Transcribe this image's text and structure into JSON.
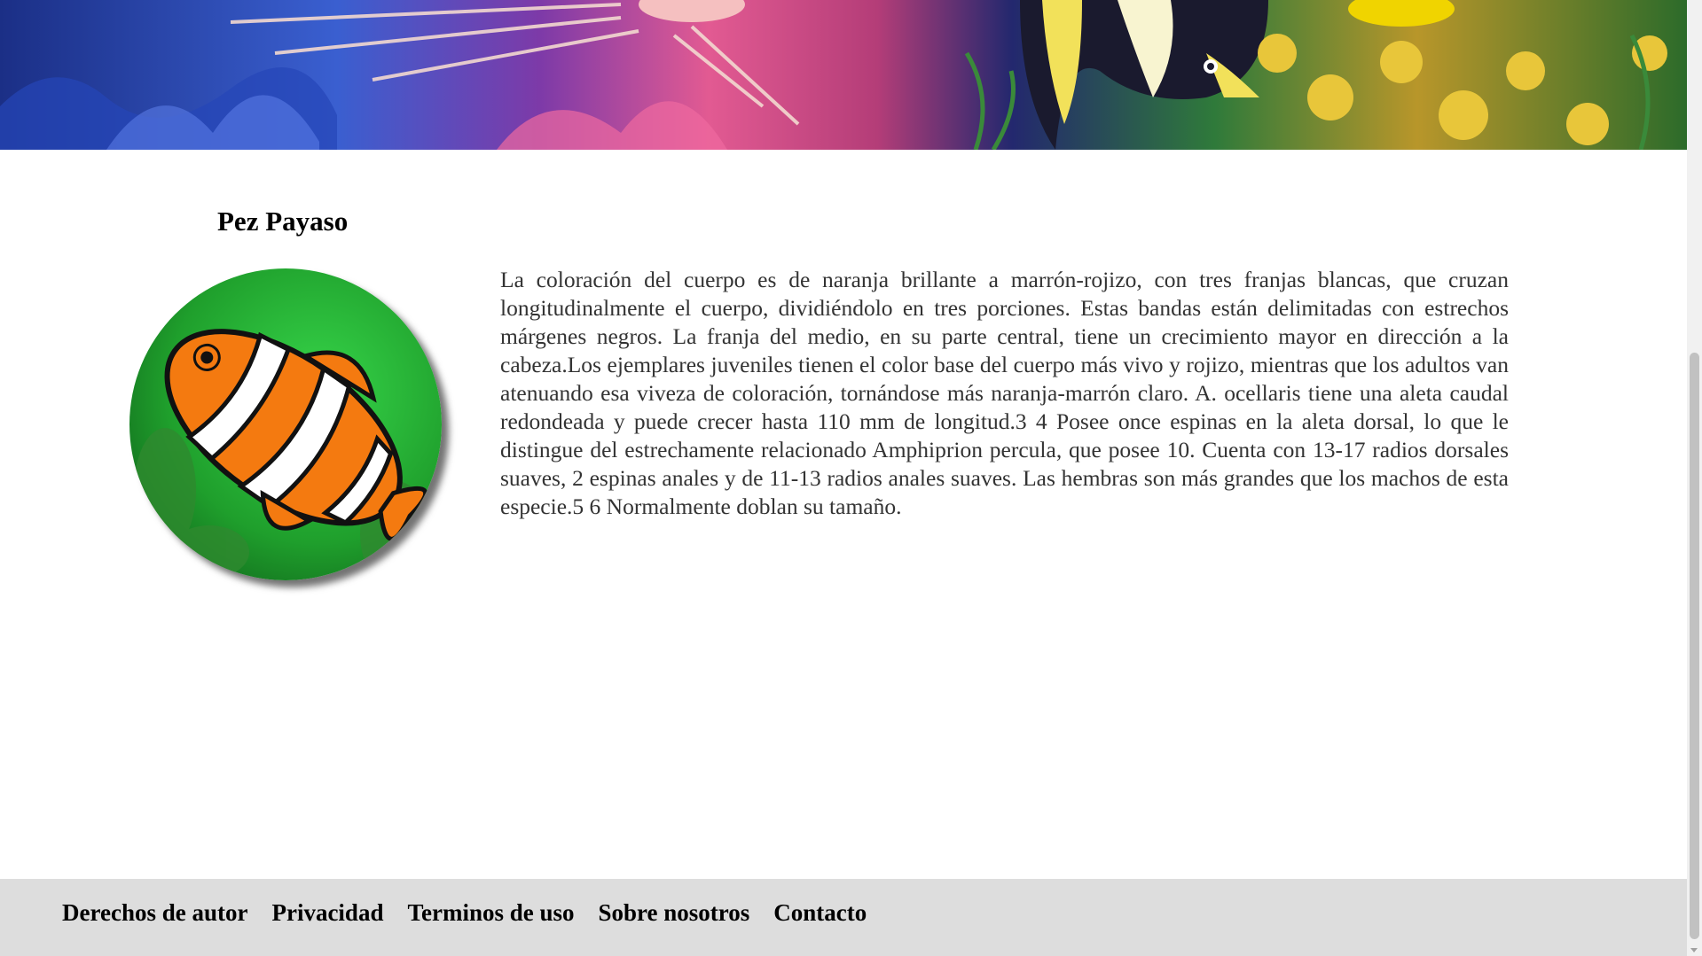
{
  "banner": {
    "image": "coral-reef-fish-banner"
  },
  "main": {
    "title": "Pez Payaso",
    "image": "clownfish-photo",
    "description": "La coloración del cuerpo es de naranja brillante a marrón-rojizo, con tres franjas blancas, que cruzan longitudinalmente el cuerpo, dividiéndolo en tres porciones. Estas bandas están delimitadas con estrechos márgenes negros. La franja del medio, en su parte central, tiene un crecimiento mayor en dirección a la cabeza.Los ejemplares juveniles tienen el color base del cuerpo más vivo y rojizo, mientras que los adultos van atenuando esa viveza de coloración, tornándose más naranja-marrón claro. A. ocellaris tiene una aleta caudal redondeada y puede crecer hasta 110 mm de longitud.3 4 Posee once espinas en la aleta dorsal, lo que le distingue del estrechamente relacionado Amphiprion percula, que posee 10. Cuenta con 13-17 radios dorsales suaves, 2 espinas anales y de 11-13 radios anales suaves. Las hembras son más grandes que los machos de esta especie.5 6 Normalmente doblan su tamaño."
  },
  "footer": {
    "links": [
      {
        "label": "Derechos de autor"
      },
      {
        "label": "Privacidad"
      },
      {
        "label": "Terminos de uso"
      },
      {
        "label": "Sobre nosotros"
      },
      {
        "label": "Contacto"
      }
    ]
  },
  "colors": {
    "footer_bg": "#dddddd",
    "text": "#333333",
    "clownfish_orange": "#f47a10"
  }
}
